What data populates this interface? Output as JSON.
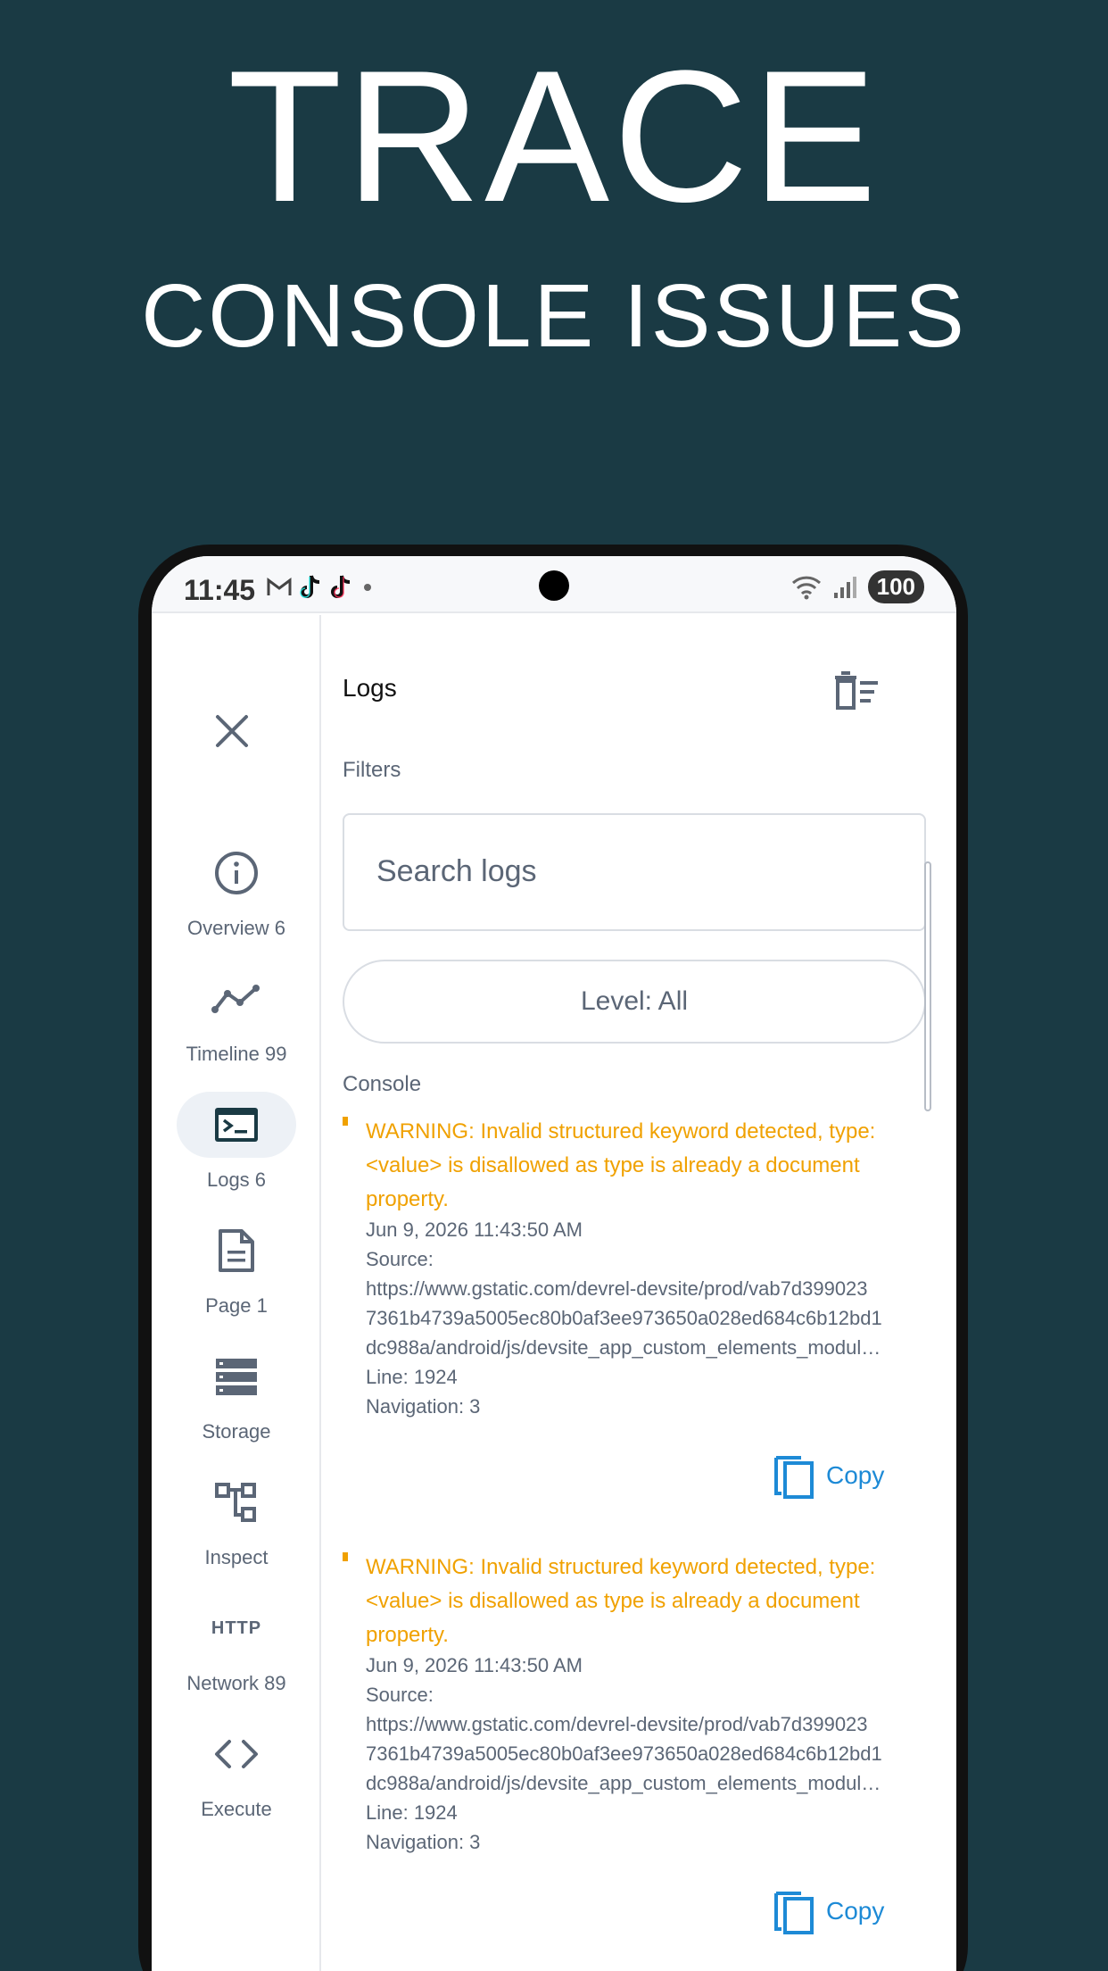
{
  "hero": {
    "title": "TRACE",
    "subtitle": "CONSOLE ISSUES"
  },
  "status_bar": {
    "time": "11:45",
    "battery": "100"
  },
  "sidebar": {
    "items": [
      {
        "label": "Overview 6",
        "icon": "info-icon"
      },
      {
        "label": "Timeline 99",
        "icon": "timeline-icon"
      },
      {
        "label": "Logs 6",
        "icon": "terminal-icon",
        "active": true
      },
      {
        "label": "Page 1",
        "icon": "document-icon"
      },
      {
        "label": "Storage",
        "icon": "storage-icon"
      },
      {
        "label": "Inspect",
        "icon": "inspect-tree-icon"
      },
      {
        "label": "Network 89",
        "icon": "http-icon"
      },
      {
        "label": "Execute",
        "icon": "code-icon"
      }
    ],
    "http_text": "HTTP"
  },
  "main": {
    "title": "Logs",
    "filters_label": "Filters",
    "search_placeholder": "Search logs",
    "level_label": "Level: All",
    "console_label": "Console",
    "entries": [
      {
        "message": "WARNING: Invalid structured keyword detected, type:<value> is disallowed as type is already a document property.",
        "timestamp": "Jun 9, 2026 11:43:50 AM",
        "source_label": "Source:",
        "source_1": "https://www.gstatic.com/devrel-devsite/prod/vab7d399023",
        "source_2": "7361b4739a5005ec80b0af3ee973650a028ed684c6b12bd1",
        "source_3": "dc988a/android/js/devsite_app_custom_elements_modul…",
        "line": "Line: 1924",
        "navigation": "Navigation: 3",
        "copy_label": "Copy"
      },
      {
        "message": "WARNING: Invalid structured keyword detected, type:<value> is disallowed as type is already a document property.",
        "timestamp": "Jun 9, 2026 11:43:50 AM",
        "source_label": "Source:",
        "source_1": "https://www.gstatic.com/devrel-devsite/prod/vab7d399023",
        "source_2": "7361b4739a5005ec80b0af3ee973650a028ed684c6b12bd1",
        "source_3": "dc988a/android/js/devsite_app_custom_elements_modul…",
        "line": "Line: 1924",
        "navigation": "Navigation: 3",
        "copy_label": "Copy"
      }
    ]
  },
  "colors": {
    "background": "#1a3a44",
    "warning": "#f0a100",
    "accent": "#1d8ad6",
    "muted": "#5b6676"
  }
}
